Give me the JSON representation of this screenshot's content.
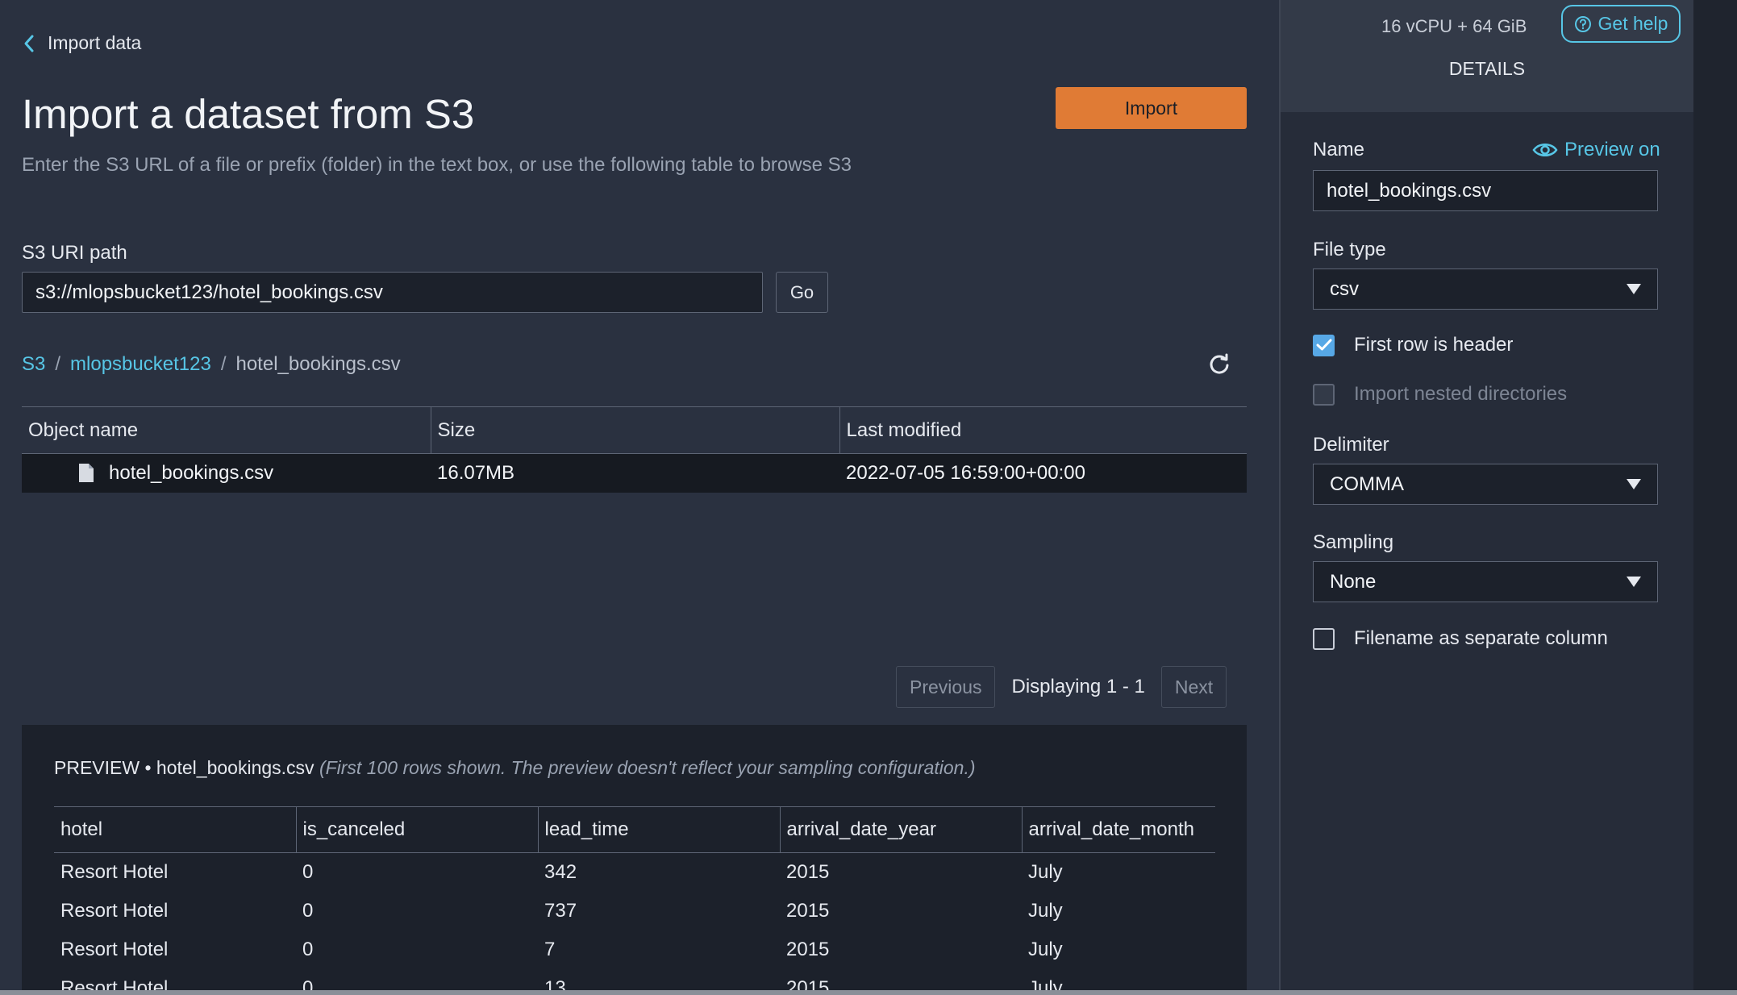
{
  "nav": {
    "back_label": "Import data"
  },
  "header": {
    "title": "Import a dataset from S3",
    "subtitle": "Enter the S3 URL of a file or prefix (folder) in the text box, or use the following table to browse S3",
    "import_label": "Import"
  },
  "s3": {
    "label": "S3 URI path",
    "value": "s3://mlopsbucket123/hotel_bookings.csv",
    "go_label": "Go"
  },
  "breadcrumb": {
    "root": "S3",
    "bucket": "mlopsbucket123",
    "file": "hotel_bookings.csv",
    "separator": "/"
  },
  "objects": {
    "columns": [
      "Object name",
      "Size",
      "Last modified"
    ],
    "rows": [
      {
        "name": "hotel_bookings.csv",
        "size": "16.07MB",
        "modified": "2022-07-05 16:59:00+00:00"
      }
    ]
  },
  "pager": {
    "previous": "Previous",
    "status": "Displaying 1 - 1",
    "next": "Next"
  },
  "preview": {
    "label": "PREVIEW",
    "bullet": "•",
    "file": "hotel_bookings.csv",
    "note": "(First 100 rows shown. The preview doesn't reflect your sampling configuration.)",
    "columns": [
      "hotel",
      "is_canceled",
      "lead_time",
      "arrival_date_year",
      "arrival_date_month"
    ],
    "rows": [
      [
        "Resort Hotel",
        "0",
        "342",
        "2015",
        "July"
      ],
      [
        "Resort Hotel",
        "0",
        "737",
        "2015",
        "July"
      ],
      [
        "Resort Hotel",
        "0",
        "7",
        "2015",
        "July"
      ],
      [
        "Resort Hotel",
        "0",
        "13",
        "2015",
        "July"
      ]
    ]
  },
  "panel": {
    "resources": "16 vCPU + 64 GiB",
    "help_label": "Get help",
    "title": "DETAILS",
    "name_label": "Name",
    "preview_toggle": "Preview on",
    "name_value": "hotel_bookings.csv",
    "file_type_label": "File type",
    "file_type_value": "csv",
    "first_row_header": "First row is header",
    "first_row_header_checked": true,
    "nested_dirs": "Import nested directories",
    "nested_dirs_checked": false,
    "delimiter_label": "Delimiter",
    "delimiter_value": "COMMA",
    "sampling_label": "Sampling",
    "sampling_value": "None",
    "filename_column": "Filename as separate column",
    "filename_column_checked": false
  },
  "colors": {
    "accent": "#57c6e6",
    "import_button": "#e07b35",
    "background": "#2a3140",
    "panel": "#262c39"
  },
  "icons": [
    "chevron-left-icon",
    "refresh-icon",
    "file-icon",
    "eye-icon",
    "help-circle-icon",
    "caret-down-icon",
    "checkmark-icon"
  ]
}
